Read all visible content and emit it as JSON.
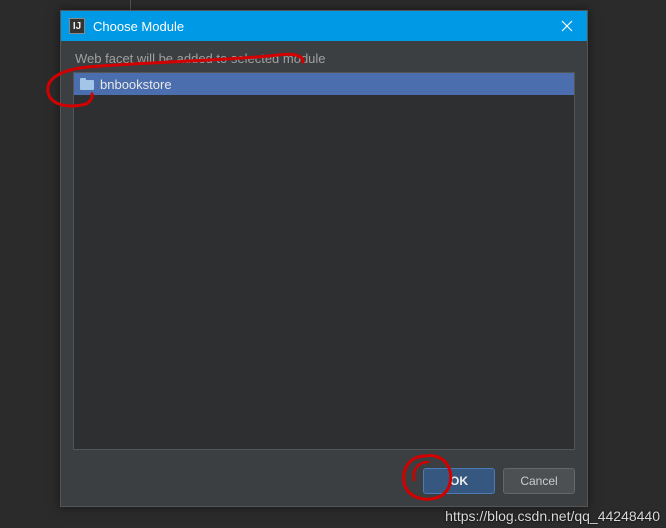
{
  "titlebar": {
    "icon_text": "IJ",
    "title": "Choose Module"
  },
  "dialog": {
    "message": "Web facet will be added to selected module",
    "modules": [
      {
        "label": "bnbookstore"
      }
    ],
    "ok_label": "OK",
    "cancel_label": "Cancel"
  },
  "watermark": "https://blog.csdn.net/qq_44248440"
}
